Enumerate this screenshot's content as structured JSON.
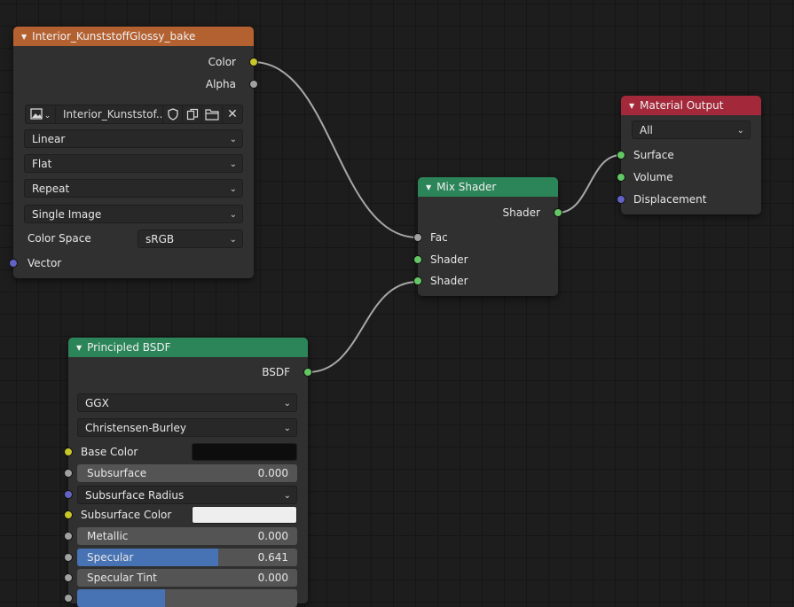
{
  "image_texture_node": {
    "title": "Interior_KunststoffGlossy_bake",
    "header_color": "#b46131",
    "outputs": {
      "color": "Color",
      "alpha": "Alpha"
    },
    "image_name": "Interior_Kunststof...",
    "interpolation": "Linear",
    "projection": "Flat",
    "extension": "Repeat",
    "source": "Single Image",
    "color_space_label": "Color Space",
    "color_space_value": "sRGB",
    "inputs": {
      "vector": "Vector"
    }
  },
  "mix_shader_node": {
    "title": "Mix Shader",
    "header_color": "#2c8559",
    "output": "Shader",
    "inputs": {
      "fac": "Fac",
      "shader1": "Shader",
      "shader2": "Shader"
    }
  },
  "material_output_node": {
    "title": "Material Output",
    "header_color": "#a3283a",
    "target": "All",
    "inputs": {
      "surface": "Surface",
      "volume": "Volume",
      "displacement": "Displacement"
    }
  },
  "principled_node": {
    "title": "Principled BSDF",
    "header_color": "#2c8559",
    "output": "BSDF",
    "distribution": "GGX",
    "subsurface_method": "Christensen-Burley",
    "base_color_label": "Base Color",
    "base_color": "#0d0d0d",
    "subsurface_label": "Subsurface",
    "subsurface_value": "0.000",
    "subsurface_radius_label": "Subsurface Radius",
    "subsurface_color_label": "Subsurface Color",
    "subsurface_color": "#eeeeee",
    "metallic_label": "Metallic",
    "metallic_value": "0.000",
    "specular_label": "Specular",
    "specular_value": "0.641",
    "specular_fraction": 0.641,
    "specular_tint_label": "Specular Tint",
    "specular_tint_value": "0.000",
    "roughness_fraction": 0.4
  },
  "icons": [
    "image-type-icon",
    "fake-user-shield-icon",
    "duplicate-icon",
    "open-folder-icon",
    "close-icon"
  ]
}
